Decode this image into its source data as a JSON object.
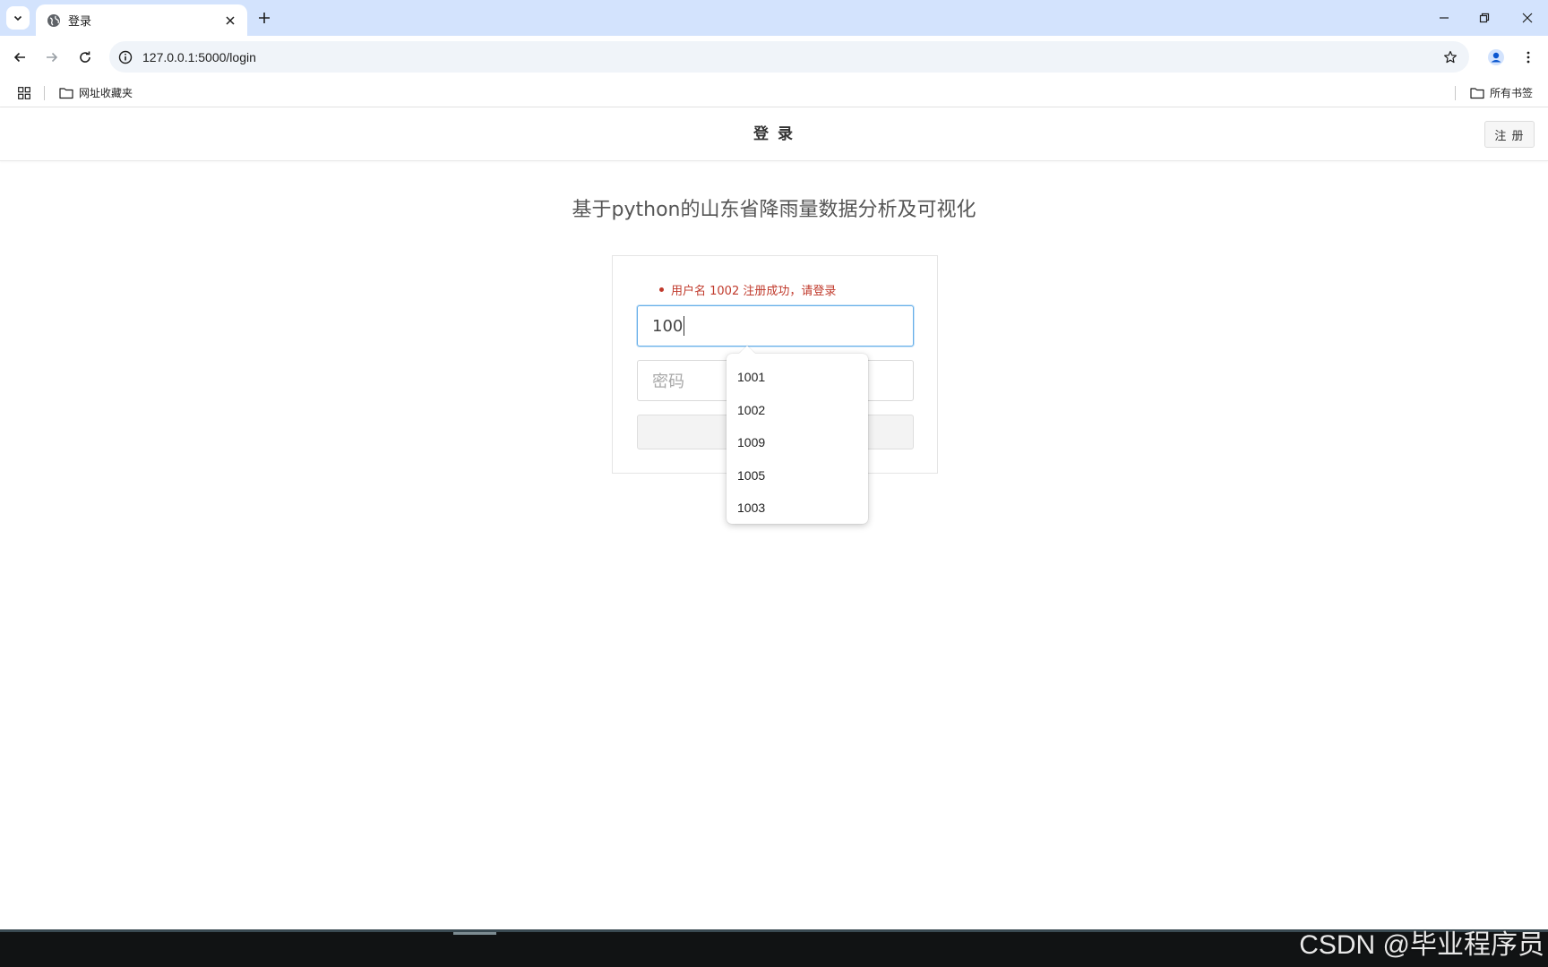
{
  "browser": {
    "tab_title": "登录",
    "url": "127.0.0.1:5000/login",
    "bookmarks": {
      "folder_left": "网址收藏夹",
      "folder_right": "所有书签"
    }
  },
  "header": {
    "title": "登 录",
    "register_label": "注 册"
  },
  "main": {
    "site_title": "基于python的山东省降雨量数据分析及可视化",
    "flash_messages": [
      "用户名 1002 注册成功，请登录"
    ],
    "username": {
      "value": "100"
    },
    "password": {
      "placeholder": "密码"
    },
    "autocomplete": [
      "1001",
      "1002",
      "1009",
      "1005",
      "1003"
    ]
  },
  "watermark": "CSDN @毕业程序员",
  "colors": {
    "tabstrip": "#d3e3fd",
    "flash_error": "#c0392b",
    "focus_border": "#66afe9"
  }
}
